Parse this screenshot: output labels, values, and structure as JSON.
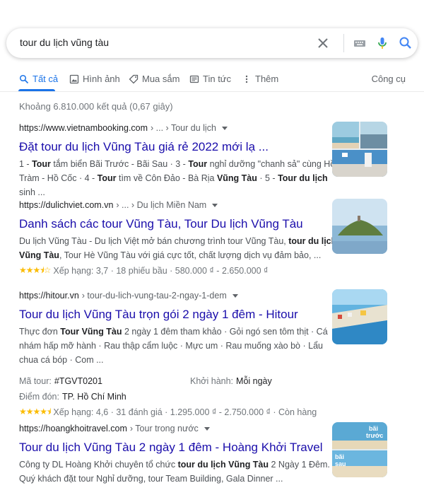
{
  "search": {
    "query": "tour du lịch vũng tàu"
  },
  "tabs": [
    {
      "label": "Tất cả",
      "icon": "search-icon",
      "active": true
    },
    {
      "label": "Hình ảnh",
      "icon": "image-icon"
    },
    {
      "label": "Mua sắm",
      "icon": "tag-icon"
    },
    {
      "label": "Tin tức",
      "icon": "news-icon"
    },
    {
      "label": "Thêm",
      "icon": "more-vert-icon"
    }
  ],
  "tools_label": "Công cụ",
  "stats": "Khoảng 6.810.000 kết quả (0,67 giây)",
  "results": [
    {
      "url": "https://www.vietnambooking.com",
      "crumb": " › ... › Tour du lịch",
      "title": "Đặt tour du lịch Vũng Tàu giá rẻ 2022 mới lạ ...",
      "snippet_parts": [
        [
          "1 - ",
          false
        ],
        [
          "Tour",
          true
        ],
        [
          " tắm biển Bãi Trước - Bãi Sau · 3 - ",
          false
        ],
        [
          "Tour",
          true
        ],
        [
          " nghỉ dưỡng \"chanh sả\" cùng Hồ Tràm - Hồ Cốc · 4 - ",
          false
        ],
        [
          "Tour",
          true
        ],
        [
          " tìm về Côn Đảo - Bà Rịa ",
          false
        ],
        [
          "Vũng Tàu",
          true
        ],
        [
          " · 5 - ",
          false
        ],
        [
          "Tour du lịch",
          true
        ],
        [
          " sinh ...",
          false
        ]
      ]
    },
    {
      "url": "https://dulichviet.com.vn",
      "crumb": " › ... › Du lịch Miền Nam",
      "title": "Danh sách các tour Vũng Tàu, Tour Du lịch Vũng Tàu",
      "snippet_parts": [
        [
          "Du lịch Vũng Tàu - Du lịch Việt mở bán chương trình tour Vũng Tàu, ",
          false
        ],
        [
          "tour du lịch Vũng Tàu",
          true
        ],
        [
          ", Tour Hè Vũng Tàu với giá cực tốt, chất lượng dịch vụ đảm bảo, ...",
          false
        ]
      ],
      "rating": {
        "stars": 3.7,
        "text": "Xếp hạng: 3,7 · 18 phiếu bầu · 580.000 ₫ - 2.650.000 ₫"
      }
    },
    {
      "url": "https://hitour.vn",
      "crumb": " › tour-du-lich-vung-tau-2-ngay-1-dem",
      "title": "Tour du lịch Vũng Tàu trọn gói 2 ngày 1 đêm - Hitour",
      "snippet_parts": [
        [
          "Thực đơn ",
          false
        ],
        [
          "Tour Vũng Tàu",
          true
        ],
        [
          " 2 ngày 1 đêm tham khảo · Gỏi ngó sen tôm thịt · Cá nhám hấp mỡ hành · Rau thập cẩm luộc · Mực um · Rau muống xào bò · Lẩu chua cá bóp · Com ...",
          false
        ]
      ],
      "facts": [
        {
          "k": "Mã tour:",
          "v": "#TGVT0201",
          "k2": "Khởi hành:",
          "v2": "Mỗi ngày"
        },
        {
          "k": "Điểm đón:",
          "v": "TP. Hồ Chí Minh"
        }
      ],
      "rating": {
        "stars": 4.6,
        "text": "Xếp hạng: 4,6 · 31 đánh giá · 1.295.000 ₫ - 2.750.000 ₫ · Còn hàng"
      }
    },
    {
      "url": "https://hoangkhoitravel.com",
      "crumb": " › Tour trong nước",
      "title": "Tour du lịch Vũng Tàu 2 ngày 1 đêm - Hoàng Khởi Travel",
      "snippet_parts": [
        [
          "Công ty DL Hoàng Khởi chuyên tổ chức ",
          false
        ],
        [
          "tour du lịch Vũng Tàu",
          true
        ],
        [
          " 2 Ngày 1 Đêm. Quý khách đặt tour Nghỉ dưỡng, tour Team Building, Gala Dinner ...",
          false
        ]
      ],
      "thumb_text": [
        "bãi",
        "trước",
        "bãi",
        "sau"
      ]
    }
  ],
  "colors": {
    "link": "#1a0dab",
    "accent": "#1a73e8",
    "star": "#fbbc04"
  }
}
